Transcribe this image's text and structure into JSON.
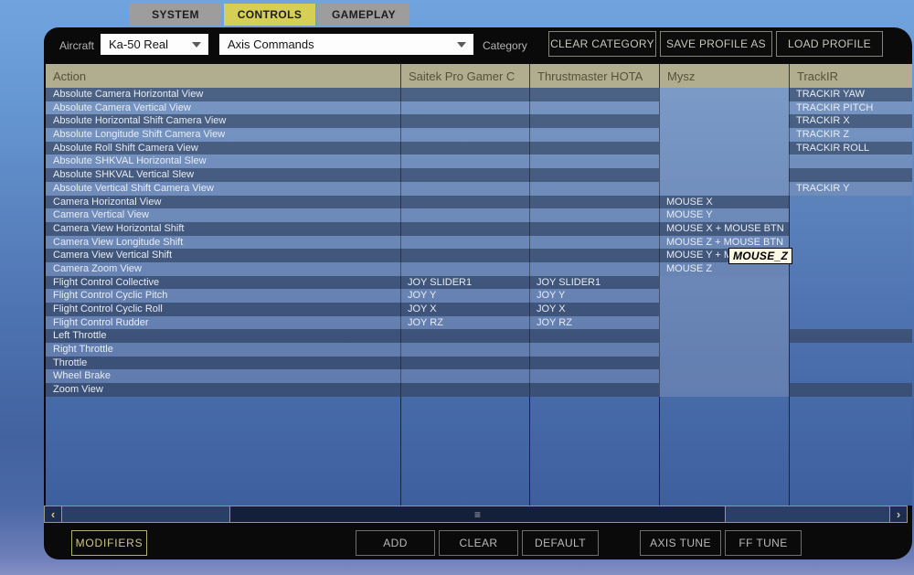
{
  "tabs": [
    {
      "label": "SYSTEM",
      "active": false
    },
    {
      "label": "CONTROLS",
      "active": true
    },
    {
      "label": "GAMEPLAY",
      "active": false
    }
  ],
  "toolbar": {
    "aircraft_label": "Aircraft",
    "aircraft_value": "Ka-50 Real",
    "category_value": "Axis Commands",
    "category_label": "Category",
    "clear_category_label": "CLEAR CATEGORY",
    "save_profile_label": "SAVE PROFILE AS",
    "load_profile_label": "LOAD PROFILE"
  },
  "table": {
    "columns": [
      "Action",
      "Saitek Pro Gamer C",
      "Thrustmaster HOTA",
      "Mysz",
      "TrackIR"
    ],
    "rows": [
      {
        "action": "Absolute Camera Horizontal View",
        "saitek": "",
        "thrustmaster": "",
        "mysz": "",
        "trackir": "TRACKIR YAW"
      },
      {
        "action": "Absolute Camera Vertical View",
        "saitek": "",
        "thrustmaster": "",
        "mysz": "",
        "trackir": "TRACKIR PITCH"
      },
      {
        "action": "Absolute Horizontal Shift Camera View",
        "saitek": "",
        "thrustmaster": "",
        "mysz": "",
        "trackir": "TRACKIR X"
      },
      {
        "action": "Absolute Longitude Shift Camera View",
        "saitek": "",
        "thrustmaster": "",
        "mysz": "",
        "trackir": "TRACKIR Z"
      },
      {
        "action": "Absolute Roll Shift Camera View",
        "saitek": "",
        "thrustmaster": "",
        "mysz": "",
        "trackir": "TRACKIR ROLL"
      },
      {
        "action": "Absolute SHKVAL Horizontal Slew",
        "saitek": "",
        "thrustmaster": "",
        "mysz": "",
        "trackir": ""
      },
      {
        "action": "Absolute SHKVAL Vertical Slew",
        "saitek": "",
        "thrustmaster": "",
        "mysz": "",
        "trackir": ""
      },
      {
        "action": "Absolute Vertical Shift Camera View",
        "saitek": "",
        "thrustmaster": "",
        "mysz": "",
        "trackir": "TRACKIR Y"
      },
      {
        "action": "Camera Horizontal View",
        "saitek": "",
        "thrustmaster": "",
        "mysz": "MOUSE X",
        "trackir": ""
      },
      {
        "action": "Camera Vertical View",
        "saitek": "",
        "thrustmaster": "",
        "mysz": "MOUSE Y",
        "trackir": ""
      },
      {
        "action": "Camera View Horizontal Shift",
        "saitek": "",
        "thrustmaster": "",
        "mysz": "MOUSE X + MOUSE BTN",
        "trackir": ""
      },
      {
        "action": "Camera View Longitude Shift",
        "saitek": "",
        "thrustmaster": "",
        "mysz": "MOUSE Z + MOUSE BTN",
        "trackir": ""
      },
      {
        "action": "Camera View Vertical Shift",
        "saitek": "",
        "thrustmaster": "",
        "mysz": "MOUSE Y + M",
        "trackir": ""
      },
      {
        "action": "Camera Zoom View",
        "saitek": "",
        "thrustmaster": "",
        "mysz": "MOUSE Z",
        "trackir": ""
      },
      {
        "action": "Flight Control Collective",
        "saitek": "JOY SLIDER1",
        "thrustmaster": "JOY SLIDER1",
        "mysz": "",
        "trackir": ""
      },
      {
        "action": "Flight Control Cyclic Pitch",
        "saitek": "JOY Y",
        "thrustmaster": "JOY Y",
        "mysz": "",
        "trackir": ""
      },
      {
        "action": "Flight Control Cyclic Roll",
        "saitek": "JOY X",
        "thrustmaster": "JOY X",
        "mysz": "",
        "trackir": ""
      },
      {
        "action": "Flight Control Rudder",
        "saitek": "JOY RZ",
        "thrustmaster": "JOY RZ",
        "mysz": "",
        "trackir": ""
      },
      {
        "action": "Left Throttle",
        "saitek": "",
        "thrustmaster": "",
        "mysz": "",
        "trackir": ""
      },
      {
        "action": "Right Throttle",
        "saitek": "",
        "thrustmaster": "",
        "mysz": "",
        "trackir": ""
      },
      {
        "action": "Throttle",
        "saitek": "",
        "thrustmaster": "",
        "mysz": "",
        "trackir": ""
      },
      {
        "action": "Wheel Brake",
        "saitek": "",
        "thrustmaster": "",
        "mysz": "",
        "trackir": ""
      },
      {
        "action": "Zoom View",
        "saitek": "",
        "thrustmaster": "",
        "mysz": "",
        "trackir": ""
      }
    ]
  },
  "tooltip": {
    "text": "MOUSE_Z"
  },
  "scrollbar": {
    "left_arrow": "‹",
    "right_arrow": "›",
    "grip": "≡"
  },
  "footer": {
    "modifiers_label": "MODIFIERS",
    "add_label": "ADD",
    "clear_label": "CLEAR",
    "default_label": "DEFAULT",
    "axis_tune_label": "AXIS TUNE",
    "ff_tune_label": "FF TUNE"
  },
  "colors": {
    "active_tab": "#d5cf55",
    "inactive_tab": "#9d9d9d",
    "header_bg": "#b0ae8e",
    "window_bg": "#0a0a0a",
    "row_dark": "rgba(50,58,76,0.55)",
    "row_light": "rgba(150,160,180,0.32)"
  }
}
